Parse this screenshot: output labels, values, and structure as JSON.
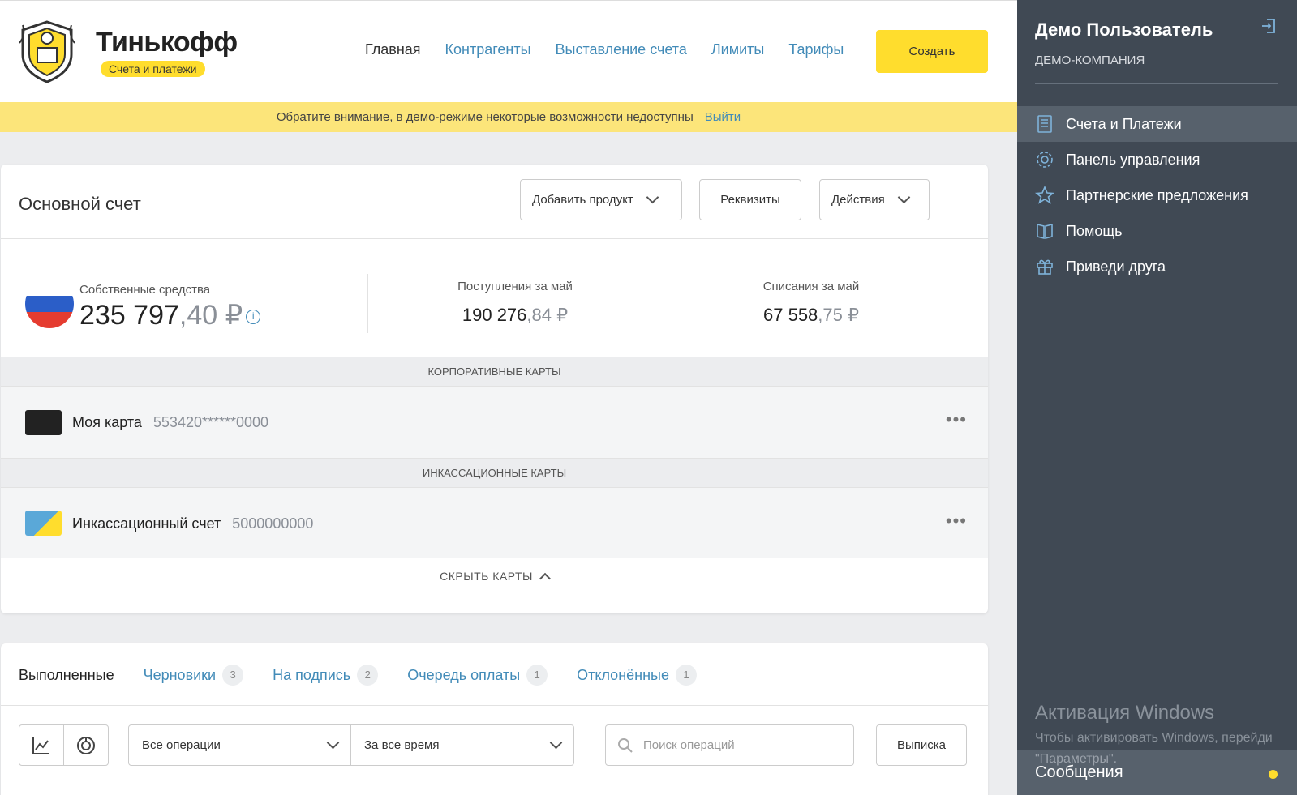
{
  "header": {
    "brand": "Тинькофф",
    "brand_sub": "Счета и платежи",
    "nav": [
      "Главная",
      "Контрагенты",
      "Выставление счета",
      "Лимиты",
      "Тарифы"
    ],
    "create_label": "Создать"
  },
  "demo_bar": {
    "text": "Обратите внимание, в демо-режиме некоторые возможности недоступны",
    "exit": "Выйти"
  },
  "account": {
    "title": "Основной счет",
    "add_product": "Добавить продукт",
    "requisites": "Реквизиты",
    "actions": "Действия",
    "own_funds_label": "Собственные средства",
    "own_funds_int": "235 797",
    "own_funds_dec": ",40 ₽",
    "income_label": "Поступления за май",
    "income_int": "190 276",
    "income_dec": ",84 ₽",
    "expense_label": "Списания за май",
    "expense_int": "67 558",
    "expense_dec": ",75 ₽",
    "corporate_cards_head": "КОРПОРАТИВНЫЕ КАРТЫ",
    "card1_name": "Моя карта",
    "card1_num": "553420******0000",
    "collection_cards_head": "ИНКАССАЦИОННЫЕ КАРТЫ",
    "card2_name": "Инкассационный счет",
    "card2_num": "5000000000",
    "hide_cards": "СКРЫТЬ КАРТЫ"
  },
  "operations": {
    "tabs": [
      {
        "label": "Выполненные",
        "count": ""
      },
      {
        "label": "Черновики",
        "count": "3"
      },
      {
        "label": "На подпись",
        "count": "2"
      },
      {
        "label": "Очередь оплаты",
        "count": "1"
      },
      {
        "label": "Отклонённые",
        "count": "1"
      }
    ],
    "type_select": "Все операции",
    "period_select": "За все время",
    "search_placeholder": "Поиск операций",
    "statement": "Выписка"
  },
  "sidebar": {
    "user_name": "Демо Пользователь",
    "company": "ДЕМО-КОМПАНИЯ",
    "menu": [
      {
        "label": "Счета и Платежи",
        "icon": "document-icon"
      },
      {
        "label": "Панель управления",
        "icon": "gear-icon"
      },
      {
        "label": "Партнерские предложения",
        "icon": "star-icon"
      },
      {
        "label": "Помощь",
        "icon": "book-icon"
      },
      {
        "label": "Приведи друга",
        "icon": "gift-icon"
      }
    ],
    "watermark_title": "Активация Windows",
    "watermark_sub": "Чтобы активировать Windows, перейди",
    "watermark_sub2": "\"Параметры\".",
    "messages": "Сообщения"
  },
  "colors": {
    "accent_yellow": "#ffdd2d",
    "link_blue": "#428bb8",
    "sidebar_bg": "#404954"
  }
}
